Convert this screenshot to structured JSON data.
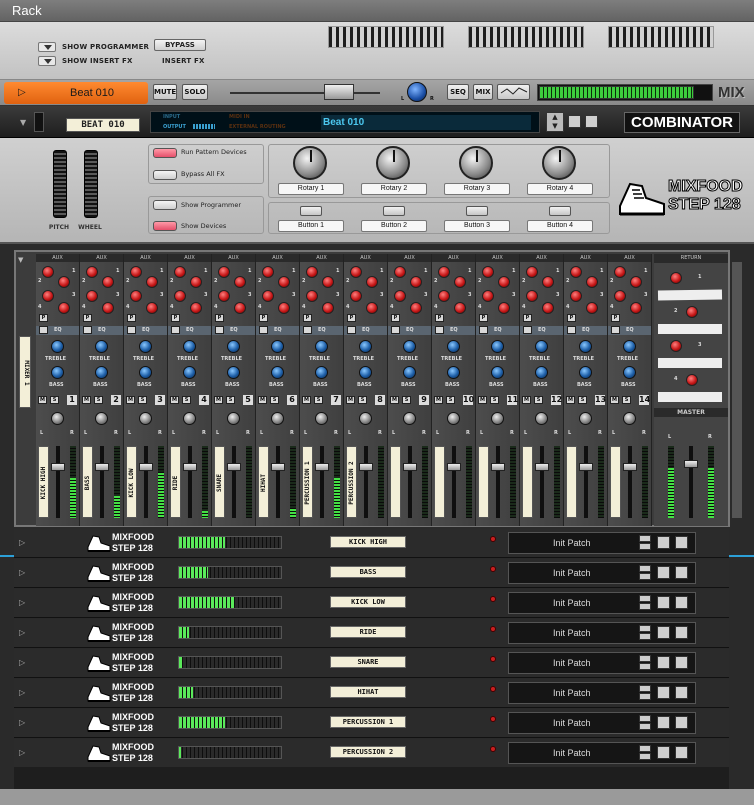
{
  "window": {
    "title": "Rack"
  },
  "top_strip": {
    "show_programmer": "SHOW PROGRAMMER",
    "show_insert_fx": "SHOW INSERT FX",
    "bypass": "BYPASS",
    "insert_fx": "INSERT FX"
  },
  "mix_bar": {
    "device_name": "Beat 010",
    "mute": "MUTE",
    "solo": "SOLO",
    "level_left": "L",
    "level_right": "R",
    "seq": "SEQ",
    "mix": "MIX",
    "brand": "MIX",
    "level": 0.72,
    "meter_level": 0.9
  },
  "combinator": {
    "patch_label": "BEAT 010",
    "input": "INPUT",
    "output": "OUTPUT",
    "midi_in": "MIDI IN",
    "external_routing": "EXTERNAL ROUTING",
    "patch_name": "Beat 010",
    "title": "COMBINATOR"
  },
  "controls": {
    "pitch": "PITCH",
    "wheel": "WHEEL",
    "run_pattern": "Run Pattern Devices",
    "bypass_all": "Bypass All FX",
    "show_programmer": "Show Programmer",
    "show_devices": "Show Devices",
    "rotaries": [
      "Rotary 1",
      "Rotary 2",
      "Rotary 3",
      "Rotary 4"
    ],
    "buttons": [
      "Button 1",
      "Button 2",
      "Button 3",
      "Button 4"
    ],
    "logo_line1": "MIXFOOD",
    "logo_line2": "STEP 128"
  },
  "mixer": {
    "side_label": "MIXER 1",
    "aux": "AUX",
    "eq": "EQ",
    "treble": "TREBLE",
    "bass": "BASS",
    "m": "M",
    "s": "S",
    "p": "P",
    "l": "L",
    "r": "R",
    "return": "RETURN",
    "master": "MASTER",
    "aux_nums": [
      "1",
      "2",
      "3",
      "4"
    ],
    "channels": [
      {
        "num": "1",
        "label": "KICK HIGH",
        "fader": 0.72,
        "vu": 0.55
      },
      {
        "num": "2",
        "label": "BASS",
        "fader": 0.72,
        "vu": 0.3
      },
      {
        "num": "3",
        "label": "KICK LOW",
        "fader": 0.72,
        "vu": 0.62
      },
      {
        "num": "4",
        "label": "RIDE",
        "fader": 0.72,
        "vu": 0.1
      },
      {
        "num": "5",
        "label": "SNARE",
        "fader": 0.72,
        "vu": 0
      },
      {
        "num": "6",
        "label": "HIHAT",
        "fader": 0.72,
        "vu": 0.12
      },
      {
        "num": "7",
        "label": "PERCUSSION 1",
        "fader": 0.72,
        "vu": 0.55
      },
      {
        "num": "8",
        "label": "PERCUSSION 2",
        "fader": 0.72,
        "vu": 0
      },
      {
        "num": "9",
        "label": "",
        "fader": 0.72,
        "vu": 0
      },
      {
        "num": "10",
        "label": "",
        "fader": 0.72,
        "vu": 0
      },
      {
        "num": "11",
        "label": "",
        "fader": 0.72,
        "vu": 0
      },
      {
        "num": "12",
        "label": "",
        "fader": 0.72,
        "vu": 0
      },
      {
        "num": "13",
        "label": "",
        "fader": 0.72,
        "vu": 0
      },
      {
        "num": "14",
        "label": "",
        "fader": 0.72,
        "vu": 0
      }
    ]
  },
  "devices": [
    {
      "logo1": "MIXFOOD",
      "logo2": "STEP 128",
      "name": "KICK HIGH",
      "patch": "Init Patch",
      "meter": 0.45
    },
    {
      "logo1": "MIXFOOD",
      "logo2": "STEP 128",
      "name": "BASS",
      "patch": "Init Patch",
      "meter": 0.28
    },
    {
      "logo1": "MIXFOOD",
      "logo2": "STEP 128",
      "name": "KICK LOW",
      "patch": "Init Patch",
      "meter": 0.55
    },
    {
      "logo1": "MIXFOOD",
      "logo2": "STEP 128",
      "name": "RIDE",
      "patch": "Init Patch",
      "meter": 0.1
    },
    {
      "logo1": "MIXFOOD",
      "logo2": "STEP 128",
      "name": "SNARE",
      "patch": "Init Patch",
      "meter": 0.03
    },
    {
      "logo1": "MIXFOOD",
      "logo2": "STEP 128",
      "name": "HIHAT",
      "patch": "Init Patch",
      "meter": 0.14
    },
    {
      "logo1": "MIXFOOD",
      "logo2": "STEP 128",
      "name": "PERCUSSION 1",
      "patch": "Init Patch",
      "meter": 0.45
    },
    {
      "logo1": "MIXFOOD",
      "logo2": "STEP 128",
      "name": "PERCUSSION 2",
      "patch": "Init Patch",
      "meter": 0.02
    }
  ]
}
